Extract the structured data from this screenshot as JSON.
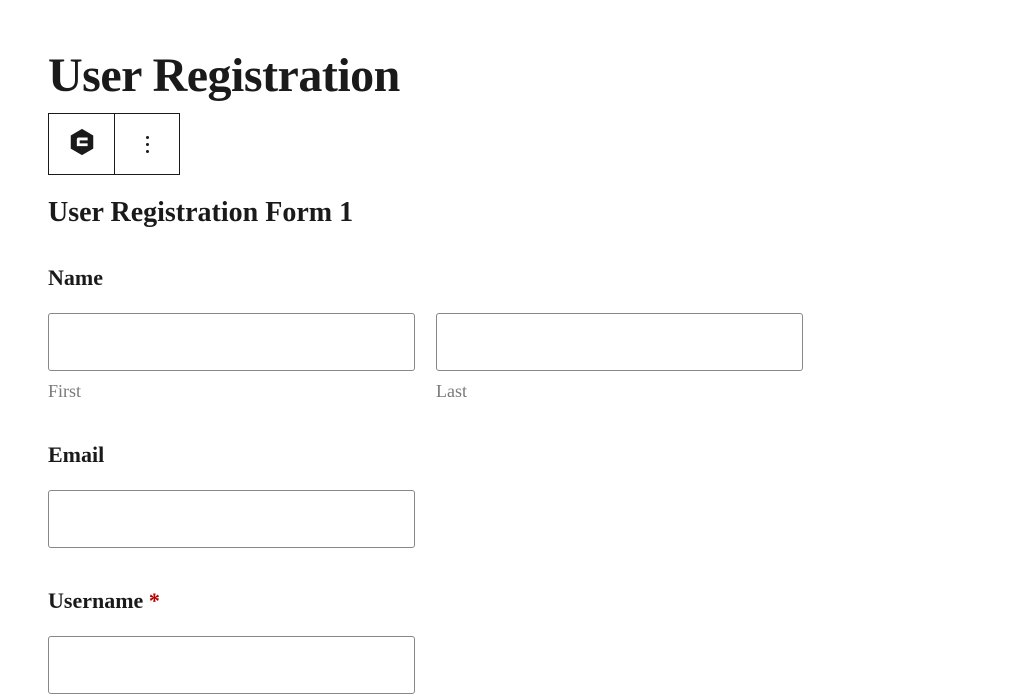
{
  "page_title": "User Registration",
  "form_title": "User Registration Form 1",
  "fields": {
    "name": {
      "label": "Name",
      "first_sublabel": "First",
      "last_sublabel": "Last",
      "first_value": "",
      "last_value": ""
    },
    "email": {
      "label": "Email",
      "value": ""
    },
    "username": {
      "label": "Username",
      "required_marker": "*",
      "value": ""
    }
  },
  "icons": {
    "block_icon": "gravity-forms-icon",
    "more_icon": "more-vertical-icon"
  }
}
